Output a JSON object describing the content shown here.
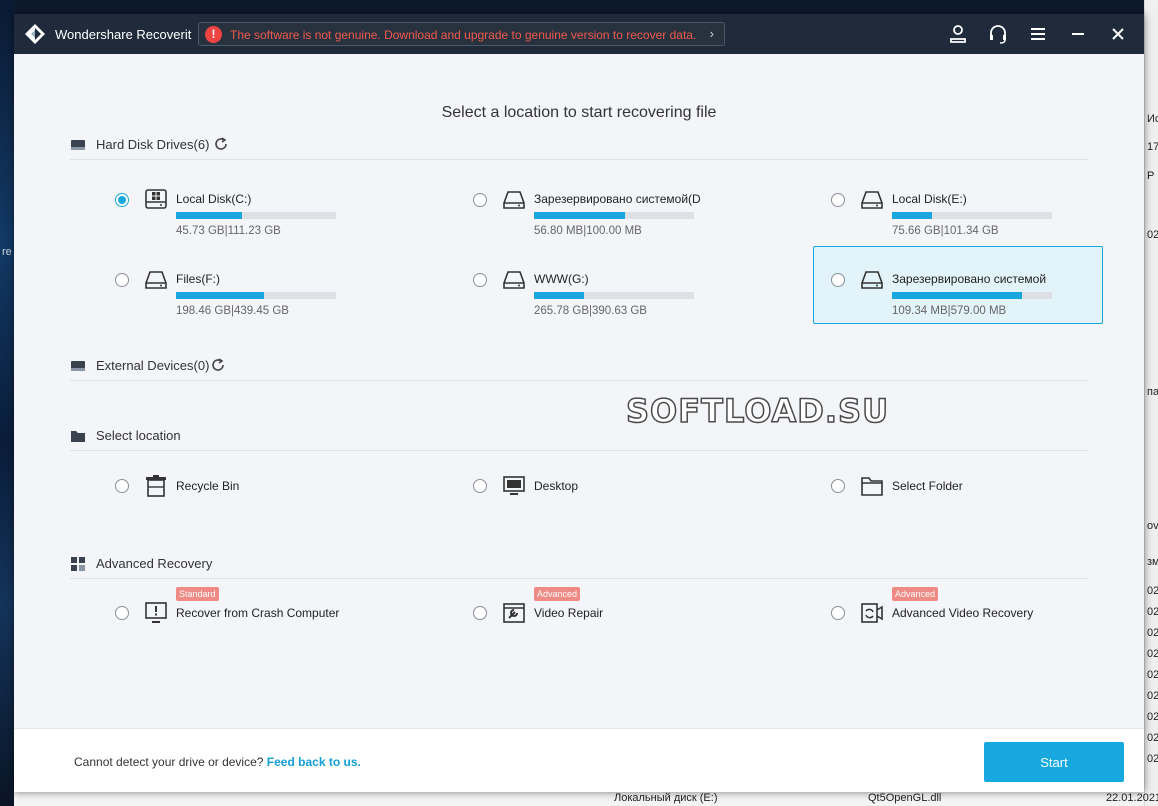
{
  "app": {
    "title": "Wondershare Recoverit",
    "warning": "The software is not genuine. Download and upgrade to genuine version to recover data.",
    "warning_arrow": "›",
    "warning_icon": "!"
  },
  "colors": {
    "accent": "#17a8e0",
    "titlebar": "#1f2b3a",
    "warning_text": "#f05a4e",
    "badge": "#f08a84"
  },
  "main": {
    "heading": "Select a location to start recovering file"
  },
  "sections": {
    "hard_disks": {
      "label": "Hard Disk Drives(6)",
      "drives": [
        {
          "name": "Local Disk(C:)",
          "size": "45.73 GB|111.23 GB",
          "usage": 0.41,
          "selected": true,
          "icon": "windows-drive-icon"
        },
        {
          "name": "Зарезервировано системой(D",
          "size": "56.80 MB|100.00 MB",
          "usage": 0.57,
          "selected": false,
          "icon": "drive-icon"
        },
        {
          "name": "Local Disk(E:)",
          "size": "75.66 GB|101.34 GB",
          "usage": 0.25,
          "selected": false,
          "icon": "drive-icon"
        },
        {
          "name": "Files(F:)",
          "size": "198.46 GB|439.45 GB",
          "usage": 0.55,
          "selected": false,
          "icon": "drive-icon"
        },
        {
          "name": "WWW(G:)",
          "size": "265.78 GB|390.63 GB",
          "usage": 0.31,
          "selected": false,
          "icon": "drive-icon"
        },
        {
          "name": "Зарезервировано системой",
          "size": "109.34 MB|579.00 MB",
          "usage": 0.81,
          "selected": false,
          "highlighted": true,
          "icon": "drive-icon"
        }
      ]
    },
    "external": {
      "label": "External Devices(0)"
    },
    "location": {
      "label": "Select location",
      "items": [
        {
          "name": "Recycle Bin",
          "icon": "recycle-bin-icon"
        },
        {
          "name": "Desktop",
          "icon": "desktop-icon"
        },
        {
          "name": "Select Folder",
          "icon": "folder-icon"
        }
      ]
    },
    "advanced": {
      "label": "Advanced Recovery",
      "items": [
        {
          "name": "Recover from Crash Computer",
          "badge": "Standard",
          "icon": "crash-computer-icon"
        },
        {
          "name": "Video Repair",
          "badge": "Advanced",
          "icon": "video-repair-icon"
        },
        {
          "name": "Advanced Video Recovery",
          "badge": "Advanced",
          "icon": "video-recovery-icon"
        }
      ]
    }
  },
  "watermark": "SOFTLOAD.SU",
  "footer": {
    "text": "Cannot detect your drive or device?",
    "link": "Feed back to us.",
    "start": "Start"
  },
  "desktop": {
    "left_text": "re",
    "right_texts": [
      "Ис",
      "178",
      "Р",
      "02 7",
      "па",
      "ove",
      "зме",
      "021",
      "021",
      "021",
      "021",
      "021",
      "021",
      "021",
      "021",
      "021"
    ],
    "bottom_file": "Qt5OpenGL.dll",
    "bottom_date": "22.01.2021",
    "bottom_left": "Локальный диск (E:)"
  }
}
